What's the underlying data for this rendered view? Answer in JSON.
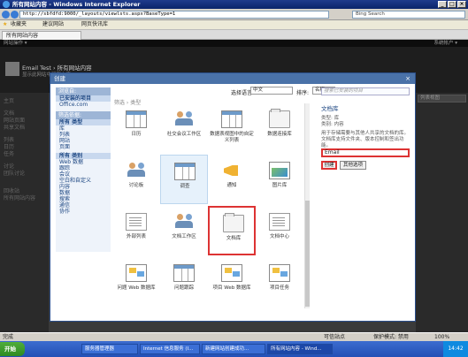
{
  "window": {
    "title": "所有网站内容 - Windows Internet Explorer"
  },
  "address": {
    "url": "http://sbfdfd:9000/_layouts/viewlsts.aspx?BaseType=1",
    "search_placeholder": "Bing Search"
  },
  "favorites": {
    "label": "收藏夹",
    "item1": "建议网站",
    "item2": "网页快讯库"
  },
  "tab": {
    "label": "所有网站内容"
  },
  "sharepoint": {
    "topnav": "网站操作 ▾",
    "user": "系统帐户 ▾",
    "site_title": "Email Test › 所有网站内容",
    "site_sub": "显示此网站中所有内容",
    "left_nav": [
      "主页",
      "文档",
      "网站页面",
      "共享文档",
      "列表",
      "日历",
      "任务",
      "讨论",
      "团队讨论",
      "回收站",
      "所有网站内容"
    ],
    "list_control": "列表视图"
  },
  "dialog": {
    "title": "创建",
    "close": "×",
    "left": {
      "browse_header": "浏览自:",
      "browse_items": [
        "已安装的项目",
        "Office.com"
      ],
      "filter_header": "筛选依据:",
      "type_label": "所有 类型",
      "type_items": [
        "库",
        "列表",
        "网站",
        "页面"
      ],
      "category_label": "所有 类别",
      "category_items": [
        "Web 数据",
        "跟踪",
        "会议",
        "空白和自定义",
        "内容",
        "数据",
        "搜索",
        "通信",
        "协作"
      ]
    },
    "filter_breadcrumb": "筛选 › 类型",
    "lang_label": "选择语言:",
    "lang_value": "中文",
    "sort_label": "排序:",
    "sort_value": "名称",
    "tiles": [
      {
        "label": "日历",
        "icon": "calendar-icon"
      },
      {
        "label": "社交会议工作区",
        "icon": "people-icon"
      },
      {
        "label": "数据表视图中的自定义列表",
        "icon": "table-icon"
      },
      {
        "label": "数据连接库",
        "icon": "folder-icon"
      },
      {
        "label": "讨论板",
        "icon": "discussion-icon"
      },
      {
        "label": "调查",
        "icon": "survey-icon"
      },
      {
        "label": "通知",
        "icon": "megaphone-icon"
      },
      {
        "label": "图片库",
        "icon": "picture-icon"
      },
      {
        "label": "外部列表",
        "icon": "external-list-icon"
      },
      {
        "label": "文档工作区",
        "icon": "people-icon"
      },
      {
        "label": "文档库",
        "icon": "folder-icon"
      },
      {
        "label": "文档中心",
        "icon": "document-icon"
      },
      {
        "label": "问题 Web 数据库",
        "icon": "board-icon"
      },
      {
        "label": "问题跟踪",
        "icon": "table-icon"
      },
      {
        "label": "项目 Web 数据库",
        "icon": "board-icon"
      },
      {
        "label": "项目任务",
        "icon": "board-icon"
      }
    ],
    "description": {
      "search_placeholder": "搜索已安装的项目",
      "title": "文档库",
      "type": "类型: 库",
      "category": "类别: 内容",
      "text": "用于存储需要与其他人共享的文档的库。文档库支持文件夹、版本控制和签出功能。",
      "name_value": "Email",
      "create_button": "创建",
      "more_button": "其他选项"
    }
  },
  "status": {
    "left": "完成",
    "sites": "可信站点",
    "protected": "保护模式: 禁用",
    "zoom": "100%"
  },
  "taskbar": {
    "start": "开始",
    "tasks": [
      "服务器管理器",
      "Internet 信息服务 (I...",
      "新建网站创建成功...",
      "所有网站内容 - Wind..."
    ],
    "clock": "14:42"
  }
}
